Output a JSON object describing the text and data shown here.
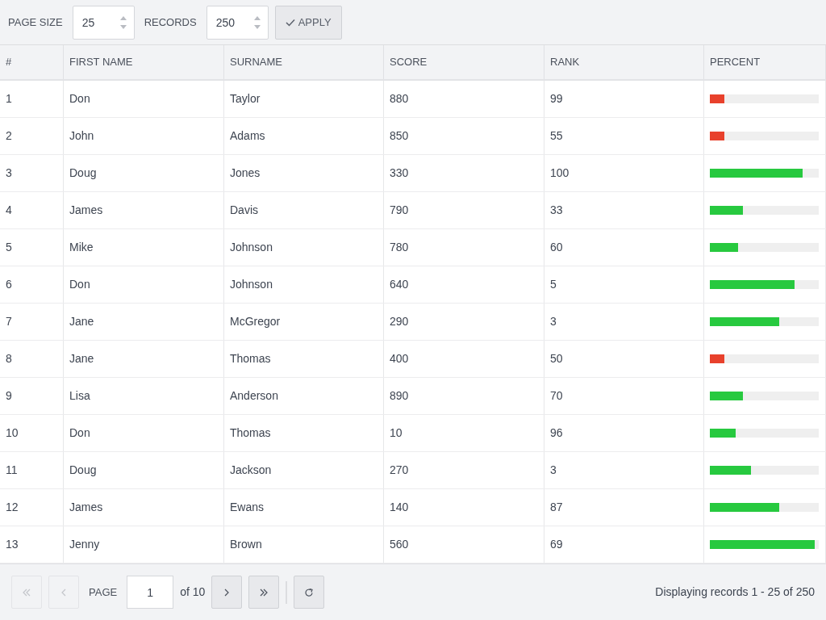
{
  "toolbar": {
    "page_size_label": "PAGE SIZE",
    "page_size": "25",
    "records_label": "RECORDS",
    "records": "250",
    "apply_button": "APPLY"
  },
  "table": {
    "columns": [
      "#",
      "FIRST NAME",
      "SURNAME",
      "SCORE",
      "RANK",
      "PERCENT"
    ],
    "rows": [
      {
        "num": "1",
        "first": "Don",
        "surname": "Taylor",
        "score": "880",
        "rank": "99",
        "level": 0.13,
        "color": "#e8412c"
      },
      {
        "num": "2",
        "first": "John",
        "surname": "Adams",
        "score": "850",
        "rank": "55",
        "level": 0.13,
        "color": "#e8412c"
      },
      {
        "num": "3",
        "first": "Doug",
        "surname": "Jones",
        "score": "330",
        "rank": "100",
        "level": 0.85,
        "color": "#27c93f"
      },
      {
        "num": "4",
        "first": "James",
        "surname": "Davis",
        "score": "790",
        "rank": "33",
        "level": 0.3,
        "color": "#27c93f"
      },
      {
        "num": "5",
        "first": "Mike",
        "surname": "Johnson",
        "score": "780",
        "rank": "60",
        "level": 0.26,
        "color": "#27c93f"
      },
      {
        "num": "6",
        "first": "Don",
        "surname": "Johnson",
        "score": "640",
        "rank": "5",
        "level": 0.78,
        "color": "#27c93f"
      },
      {
        "num": "7",
        "first": "Jane",
        "surname": "McGregor",
        "score": "290",
        "rank": "3",
        "level": 0.64,
        "color": "#27c93f"
      },
      {
        "num": "8",
        "first": "Jane",
        "surname": "Thomas",
        "score": "400",
        "rank": "50",
        "level": 0.13,
        "color": "#e8412c"
      },
      {
        "num": "9",
        "first": "Lisa",
        "surname": "Anderson",
        "score": "890",
        "rank": "70",
        "level": 0.3,
        "color": "#27c93f"
      },
      {
        "num": "10",
        "first": "Don",
        "surname": "Thomas",
        "score": "10",
        "rank": "96",
        "level": 0.24,
        "color": "#27c93f"
      },
      {
        "num": "11",
        "first": "Doug",
        "surname": "Jackson",
        "score": "270",
        "rank": "3",
        "level": 0.38,
        "color": "#27c93f"
      },
      {
        "num": "12",
        "first": "James",
        "surname": "Ewans",
        "score": "140",
        "rank": "87",
        "level": 0.64,
        "color": "#27c93f"
      },
      {
        "num": "13",
        "first": "Jenny",
        "surname": "Brown",
        "score": "560",
        "rank": "69",
        "level": 0.96,
        "color": "#27c93f"
      }
    ]
  },
  "pager": {
    "first_disabled": true,
    "prev_disabled": true,
    "next_disabled": false,
    "last_disabled": false,
    "page_label": "PAGE",
    "page": "1",
    "of_label": "of 10",
    "status": "Displaying records 1 - 25 of 250"
  }
}
